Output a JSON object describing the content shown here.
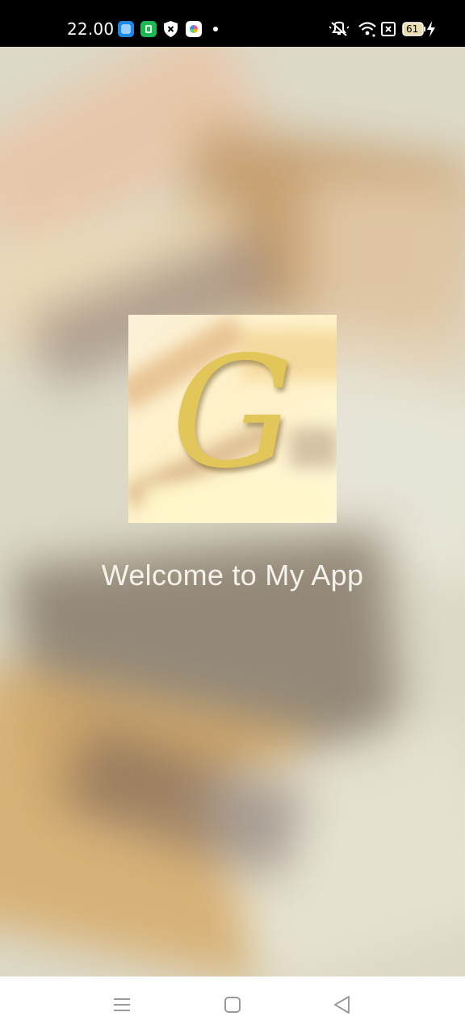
{
  "status_bar": {
    "time": "22.00",
    "battery_level": "61",
    "icons": [
      "app-icon-blue",
      "app-icon-green",
      "shield-icon",
      "app-icon-colorful",
      "notification-dot",
      "mute-icon",
      "wifi-icon",
      "screen-record-icon",
      "battery-icon",
      "charging-icon"
    ]
  },
  "splash": {
    "logo_letter": "G",
    "welcome_text": "Welcome to My App"
  },
  "nav_bar": {
    "buttons": [
      "recent-apps-button",
      "home-button",
      "back-button"
    ]
  },
  "colors": {
    "logo_gold": "#e3c65a",
    "status_bar_bg": "#000000",
    "nav_bar_bg": "#ffffff",
    "welcome_text": "#f4f2ea"
  }
}
